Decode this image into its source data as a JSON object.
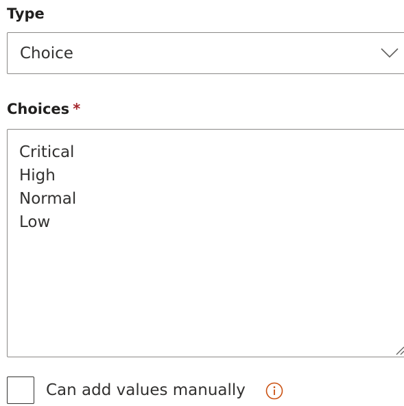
{
  "type_field": {
    "label": "Type",
    "selected_value": "Choice",
    "chevron_icon": "chevron-down-icon"
  },
  "choices_field": {
    "label": "Choices",
    "required_marker": "*",
    "lines": [
      "Critical",
      "High",
      "Normal",
      "Low"
    ]
  },
  "manual_values": {
    "label": "Can add values manually",
    "checked": false,
    "info_icon": "info-icon"
  },
  "colors": {
    "text": "#201f1e",
    "border": "#8a8886",
    "required": "#a4262c",
    "info_accent": "#ca5010",
    "background": "#ffffff"
  }
}
